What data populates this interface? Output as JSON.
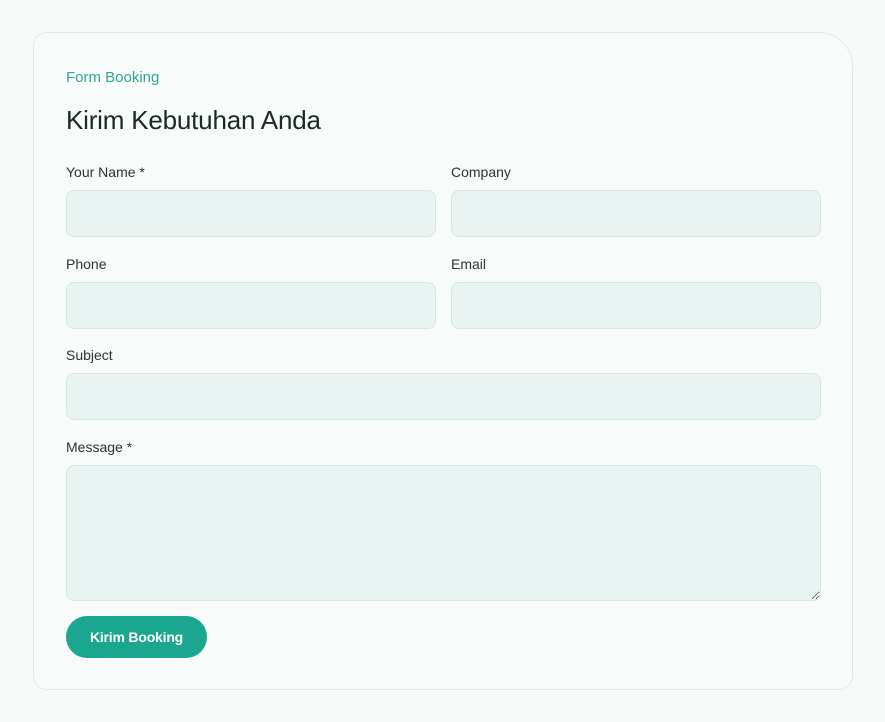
{
  "form": {
    "eyebrow": "Form Booking",
    "title": "Kirim Kebutuhan Anda",
    "fields": {
      "name": {
        "label": "Your Name *",
        "value": "",
        "placeholder": ""
      },
      "company": {
        "label": "Company",
        "value": "",
        "placeholder": ""
      },
      "phone": {
        "label": "Phone",
        "value": "",
        "placeholder": ""
      },
      "email": {
        "label": "Email",
        "value": "",
        "placeholder": ""
      },
      "subject": {
        "label": "Subject",
        "value": "",
        "placeholder": ""
      },
      "message": {
        "label": "Message *",
        "value": "",
        "placeholder": ""
      }
    },
    "submit_label": "Kirim Booking"
  },
  "colors": {
    "accent": "#1aa68f",
    "eyebrow": "#2fa58e",
    "input_bg": "#e9f3f1",
    "page_bg": "#f6fbfa"
  }
}
